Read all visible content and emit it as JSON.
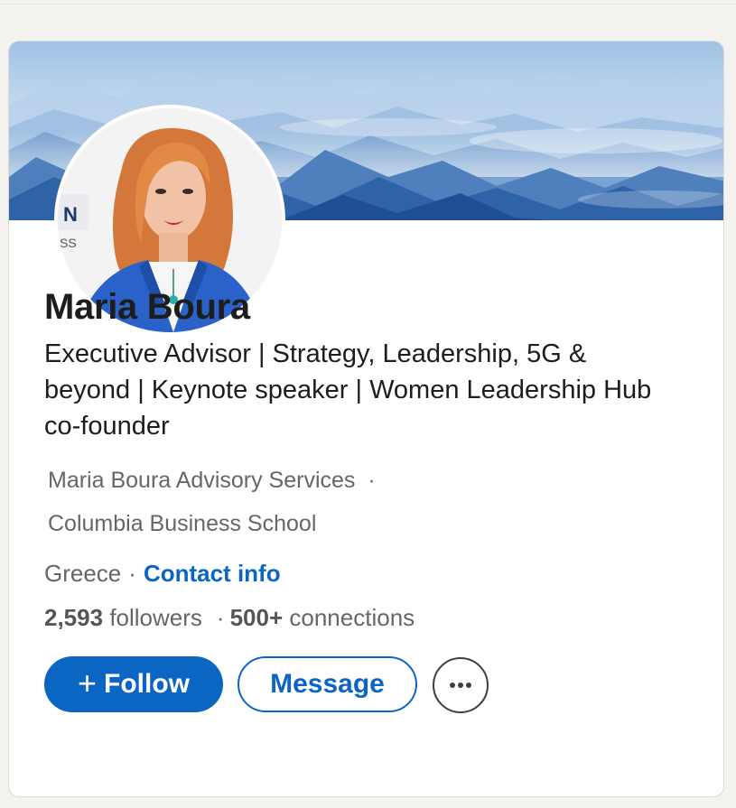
{
  "profile": {
    "name": "Maria Boura",
    "headline": "Executive Advisor | Strategy, Leadership, 5G & beyond | Keynote speaker | Women Leadership Hub co-founder",
    "company": "Maria Boura Advisory Services",
    "company_separator": "·",
    "school": "Columbia Business School",
    "location": "Greece",
    "location_separator": "·",
    "contact_info_label": "Contact info",
    "followers_count": "2,593",
    "followers_label": "followers",
    "stats_separator": "·",
    "connections_count": "500+",
    "connections_label": "connections"
  },
  "actions": {
    "follow_icon": "+",
    "follow_label": "Follow",
    "message_label": "Message",
    "more_icon": "ellipsis-icon"
  },
  "colors": {
    "primary_blue": "#0a66c2",
    "text_primary": "#1d1d1d",
    "text_secondary": "#666666",
    "page_background": "#f4f2ee"
  }
}
